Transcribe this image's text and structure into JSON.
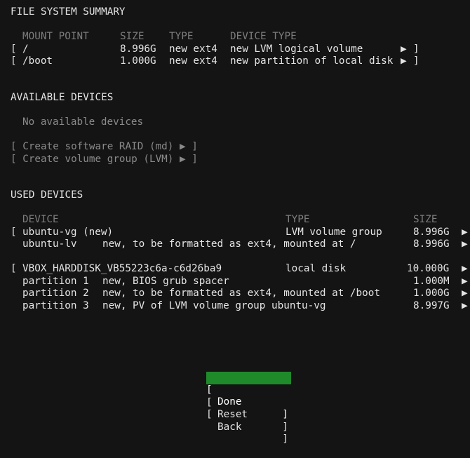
{
  "fs_summary": {
    "title": "FILE SYSTEM SUMMARY",
    "headers": {
      "mount": "MOUNT POINT",
      "size": "SIZE",
      "type": "TYPE",
      "device_type": "DEVICE TYPE"
    },
    "rows": [
      {
        "open": "[",
        "mount": "/",
        "size": "8.996G",
        "type": "new ext4",
        "device_type": "new LVM logical volume",
        "arrow": "▶",
        "close": "]"
      },
      {
        "open": "[",
        "mount": "/boot",
        "size": "1.000G",
        "type": "new ext4",
        "device_type": "new partition of local disk",
        "arrow": "▶",
        "close": "]"
      }
    ]
  },
  "available": {
    "title": "AVAILABLE DEVICES",
    "empty_text": "No available devices",
    "actions": [
      "[ Create software RAID (md) ▶ ]",
      "[ Create volume group (LVM) ▶ ]"
    ]
  },
  "used": {
    "title": "USED DEVICES",
    "headers": {
      "device": "DEVICE",
      "type": "TYPE",
      "size": "SIZE"
    },
    "groups": [
      {
        "open": "[",
        "device": "ubuntu-vg (new)",
        "type": "LVM volume group",
        "size": "8.996G",
        "arrow": "▶",
        "children": [
          {
            "name": "ubuntu-lv",
            "desc": "new, to be formatted as ext4, mounted at /",
            "size": "8.996G",
            "arrow": "▶"
          }
        ]
      },
      {
        "open": "[",
        "device": "VBOX_HARDDISK_VB55223c6a-c6d26ba9",
        "type": "local disk",
        "size": "10.000G",
        "arrow": "▶",
        "children": [
          {
            "name": "partition 1",
            "desc": "new, BIOS grub spacer",
            "size": "1.000M",
            "arrow": "▶"
          },
          {
            "name": "partition 2",
            "desc": "new, to be formatted as ext4, mounted at /boot",
            "size": "1.000G",
            "arrow": "▶"
          },
          {
            "name": "partition 3",
            "desc": "new, PV of LVM volume group ubuntu-vg",
            "size": "8.997G",
            "arrow": "▶"
          }
        ]
      }
    ]
  },
  "buttons": {
    "bracket_open": "[",
    "bracket_close": "]",
    "done": "Done",
    "reset": "Reset",
    "back": "Back"
  },
  "colors": {
    "background": "#141414",
    "text": "#e4e4e4",
    "dim": "#8a8a8a",
    "selected": "#1f8a2a"
  }
}
